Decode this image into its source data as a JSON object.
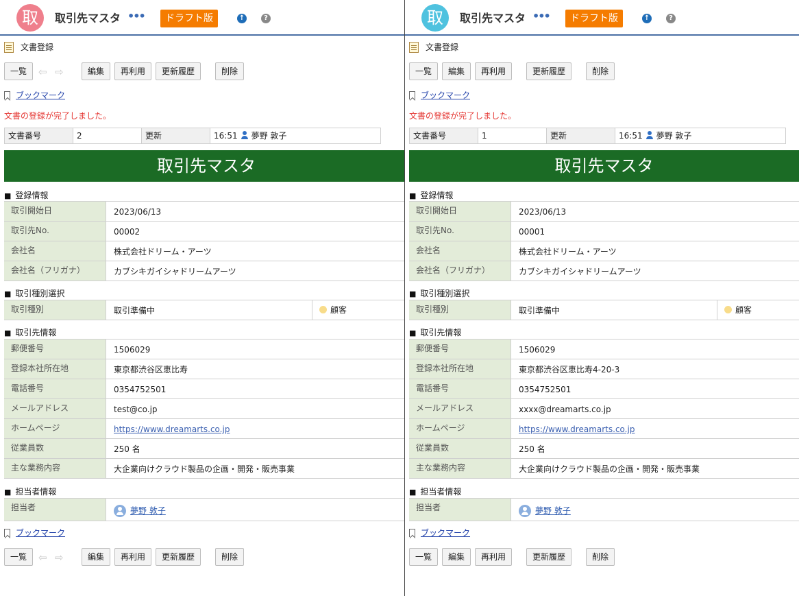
{
  "left": {
    "app_icon": "取",
    "app_title": "取引先マスタ",
    "more": "•••",
    "draft": "ドラフト版",
    "doc_reg": "文書登録",
    "buttons": {
      "list": "一覧",
      "edit": "編集",
      "reuse": "再利用",
      "history": "更新履歴",
      "delete": "削除"
    },
    "bookmark": "ブックマーク",
    "message": "文書の登録が完了しました。",
    "meta": {
      "doc_no_label": "文書番号",
      "doc_no": "2",
      "updated_label": "更新",
      "updated_time": "16:51",
      "updated_user": "夢野 敦子"
    },
    "banner": "取引先マスタ",
    "sections": {
      "reg": "登録情報",
      "type": "取引種別選択",
      "client": "取引先情報",
      "owner": "担当者情報"
    },
    "reg_rows": [
      {
        "label": "取引開始日",
        "value": "2023/06/13"
      },
      {
        "label": "取引先No.",
        "value": "00002"
      },
      {
        "label": "会社名",
        "value": "株式会社ドリーム・アーツ"
      },
      {
        "label": "会社名（フリガナ）",
        "value": "カブシキガイシャドリームアーツ"
      }
    ],
    "type_row": {
      "label": "取引種別",
      "value": "取引準備中",
      "badge": "顧客"
    },
    "client_rows": [
      {
        "label": "郵便番号",
        "value": "1506029"
      },
      {
        "label": "登録本社所在地",
        "value": "東京都渋谷区恵比寿"
      },
      {
        "label": "電話番号",
        "value": "0354752501"
      },
      {
        "label": "メールアドレス",
        "value": "test@co.jp"
      },
      {
        "label": "ホームページ",
        "value": "https://www.dreamarts.co.jp"
      },
      {
        "label": "従業員数",
        "value": "250 名"
      },
      {
        "label": "主な業務内容",
        "value": "大企業向けクラウド製品の企画・開発・販売事業"
      }
    ],
    "owner_row": {
      "label": "担当者",
      "value": "夢野 敦子"
    }
  },
  "right": {
    "app_icon": "取",
    "app_title": "取引先マスタ",
    "more": "•••",
    "draft": "ドラフト版",
    "doc_reg": "文書登録",
    "buttons": {
      "list": "一覧",
      "edit": "編集",
      "reuse": "再利用",
      "history": "更新履歴",
      "delete": "削除"
    },
    "bookmark": "ブックマーク",
    "message": "文書の登録が完了しました。",
    "meta": {
      "doc_no_label": "文書番号",
      "doc_no": "1",
      "updated_label": "更新",
      "updated_time": "16:51",
      "updated_user": "夢野 敦子"
    },
    "banner": "取引先マスタ",
    "sections": {
      "reg": "登録情報",
      "type": "取引種別選択",
      "client": "取引先情報",
      "owner": "担当者情報"
    },
    "reg_rows": [
      {
        "label": "取引開始日",
        "value": "2023/06/13"
      },
      {
        "label": "取引先No.",
        "value": "00001"
      },
      {
        "label": "会社名",
        "value": "株式会社ドリーム・アーツ"
      },
      {
        "label": "会社名（フリガナ）",
        "value": "カブシキガイシャドリームアーツ"
      }
    ],
    "type_row": {
      "label": "取引種別",
      "value": "取引準備中",
      "badge": "顧客"
    },
    "client_rows": [
      {
        "label": "郵便番号",
        "value": "1506029"
      },
      {
        "label": "登録本社所在地",
        "value": "東京都渋谷区恵比寿4-20-3"
      },
      {
        "label": "電話番号",
        "value": "0354752501"
      },
      {
        "label": "メールアドレス",
        "value": "xxxx@dreamarts.co.jp"
      },
      {
        "label": "ホームページ",
        "value": "https://www.dreamarts.co.jp"
      },
      {
        "label": "従業員数",
        "value": "250 名"
      },
      {
        "label": "主な業務内容",
        "value": "大企業向けクラウド製品の企画・開発・販売事業"
      }
    ],
    "owner_row": {
      "label": "担当者",
      "value": "夢野 敦子"
    }
  }
}
